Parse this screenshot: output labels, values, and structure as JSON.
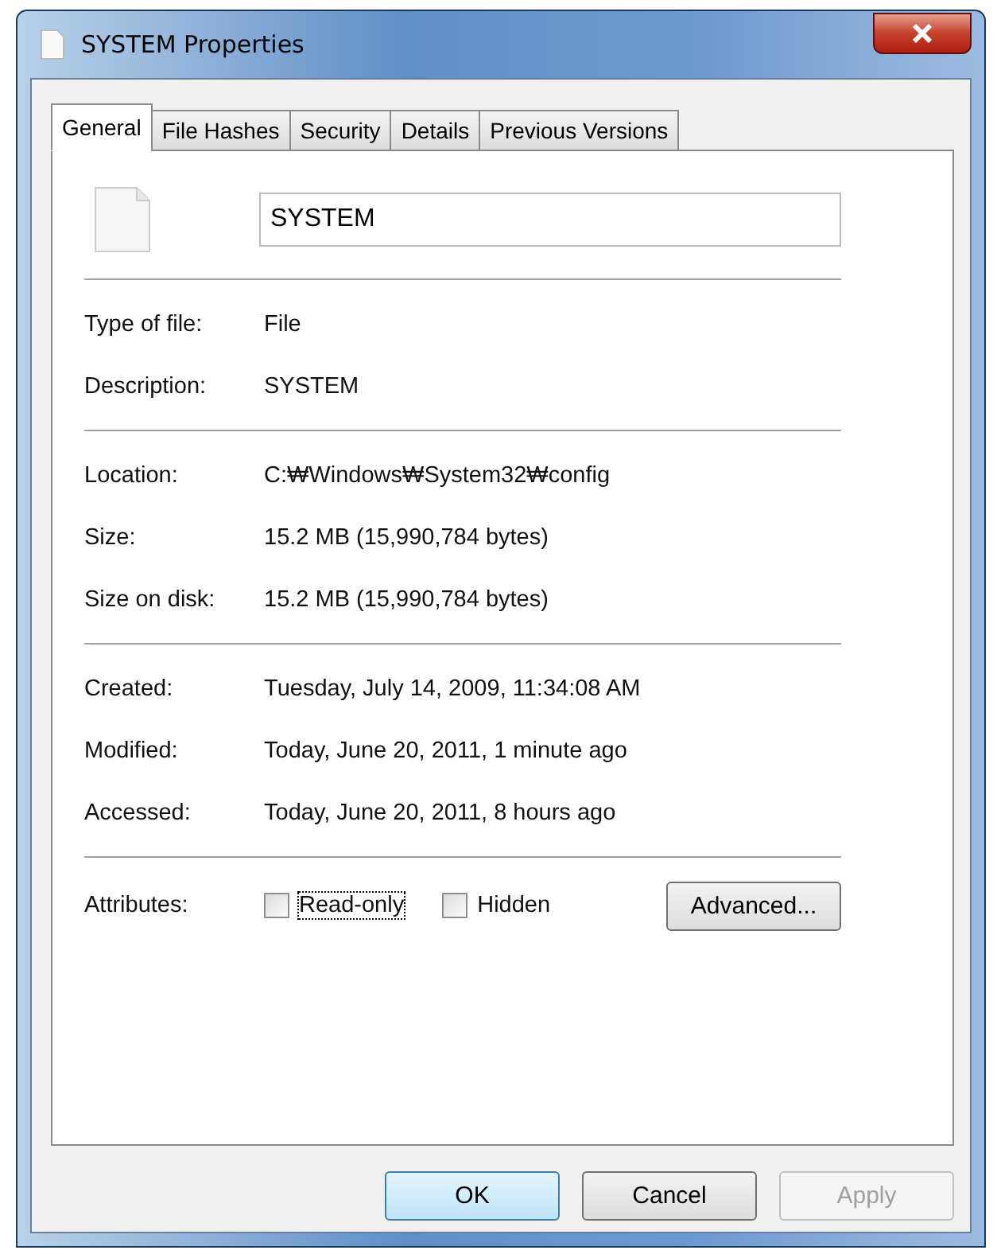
{
  "window": {
    "title": "SYSTEM Properties"
  },
  "tabs": [
    {
      "label": "General",
      "selected": true
    },
    {
      "label": "File Hashes",
      "selected": false
    },
    {
      "label": "Security",
      "selected": false
    },
    {
      "label": "Details",
      "selected": false
    },
    {
      "label": "Previous Versions",
      "selected": false
    }
  ],
  "name_field": {
    "value": "SYSTEM"
  },
  "sections": [
    {
      "rows": [
        {
          "label": "Type of file:",
          "value": "File"
        },
        {
          "label": "Description:",
          "value": "SYSTEM"
        }
      ]
    },
    {
      "rows": [
        {
          "label": "Location:",
          "value": "C:₩Windows₩System32₩config"
        },
        {
          "label": "Size:",
          "value": "15.2 MB (15,990,784 bytes)"
        },
        {
          "label": "Size on disk:",
          "value": "15.2 MB (15,990,784 bytes)"
        }
      ]
    },
    {
      "rows": [
        {
          "label": "Created:",
          "value": "Tuesday, July 14, 2009, 11:34:08 AM"
        },
        {
          "label": "Modified:",
          "value": "Today, June 20, 2011, 1 minute ago"
        },
        {
          "label": "Accessed:",
          "value": "Today, June 20, 2011, 8 hours ago"
        }
      ]
    }
  ],
  "attributes": {
    "label": "Attributes:",
    "checkboxes": [
      {
        "label": "Read-only",
        "checked": false,
        "focused": true
      },
      {
        "label": "Hidden",
        "checked": false,
        "focused": false
      }
    ],
    "advanced_button": "Advanced..."
  },
  "buttons": [
    {
      "label": "OK",
      "kind": "default",
      "disabled": false
    },
    {
      "label": "Cancel",
      "kind": "normal",
      "disabled": false
    },
    {
      "label": "Apply",
      "kind": "normal",
      "disabled": true
    }
  ]
}
